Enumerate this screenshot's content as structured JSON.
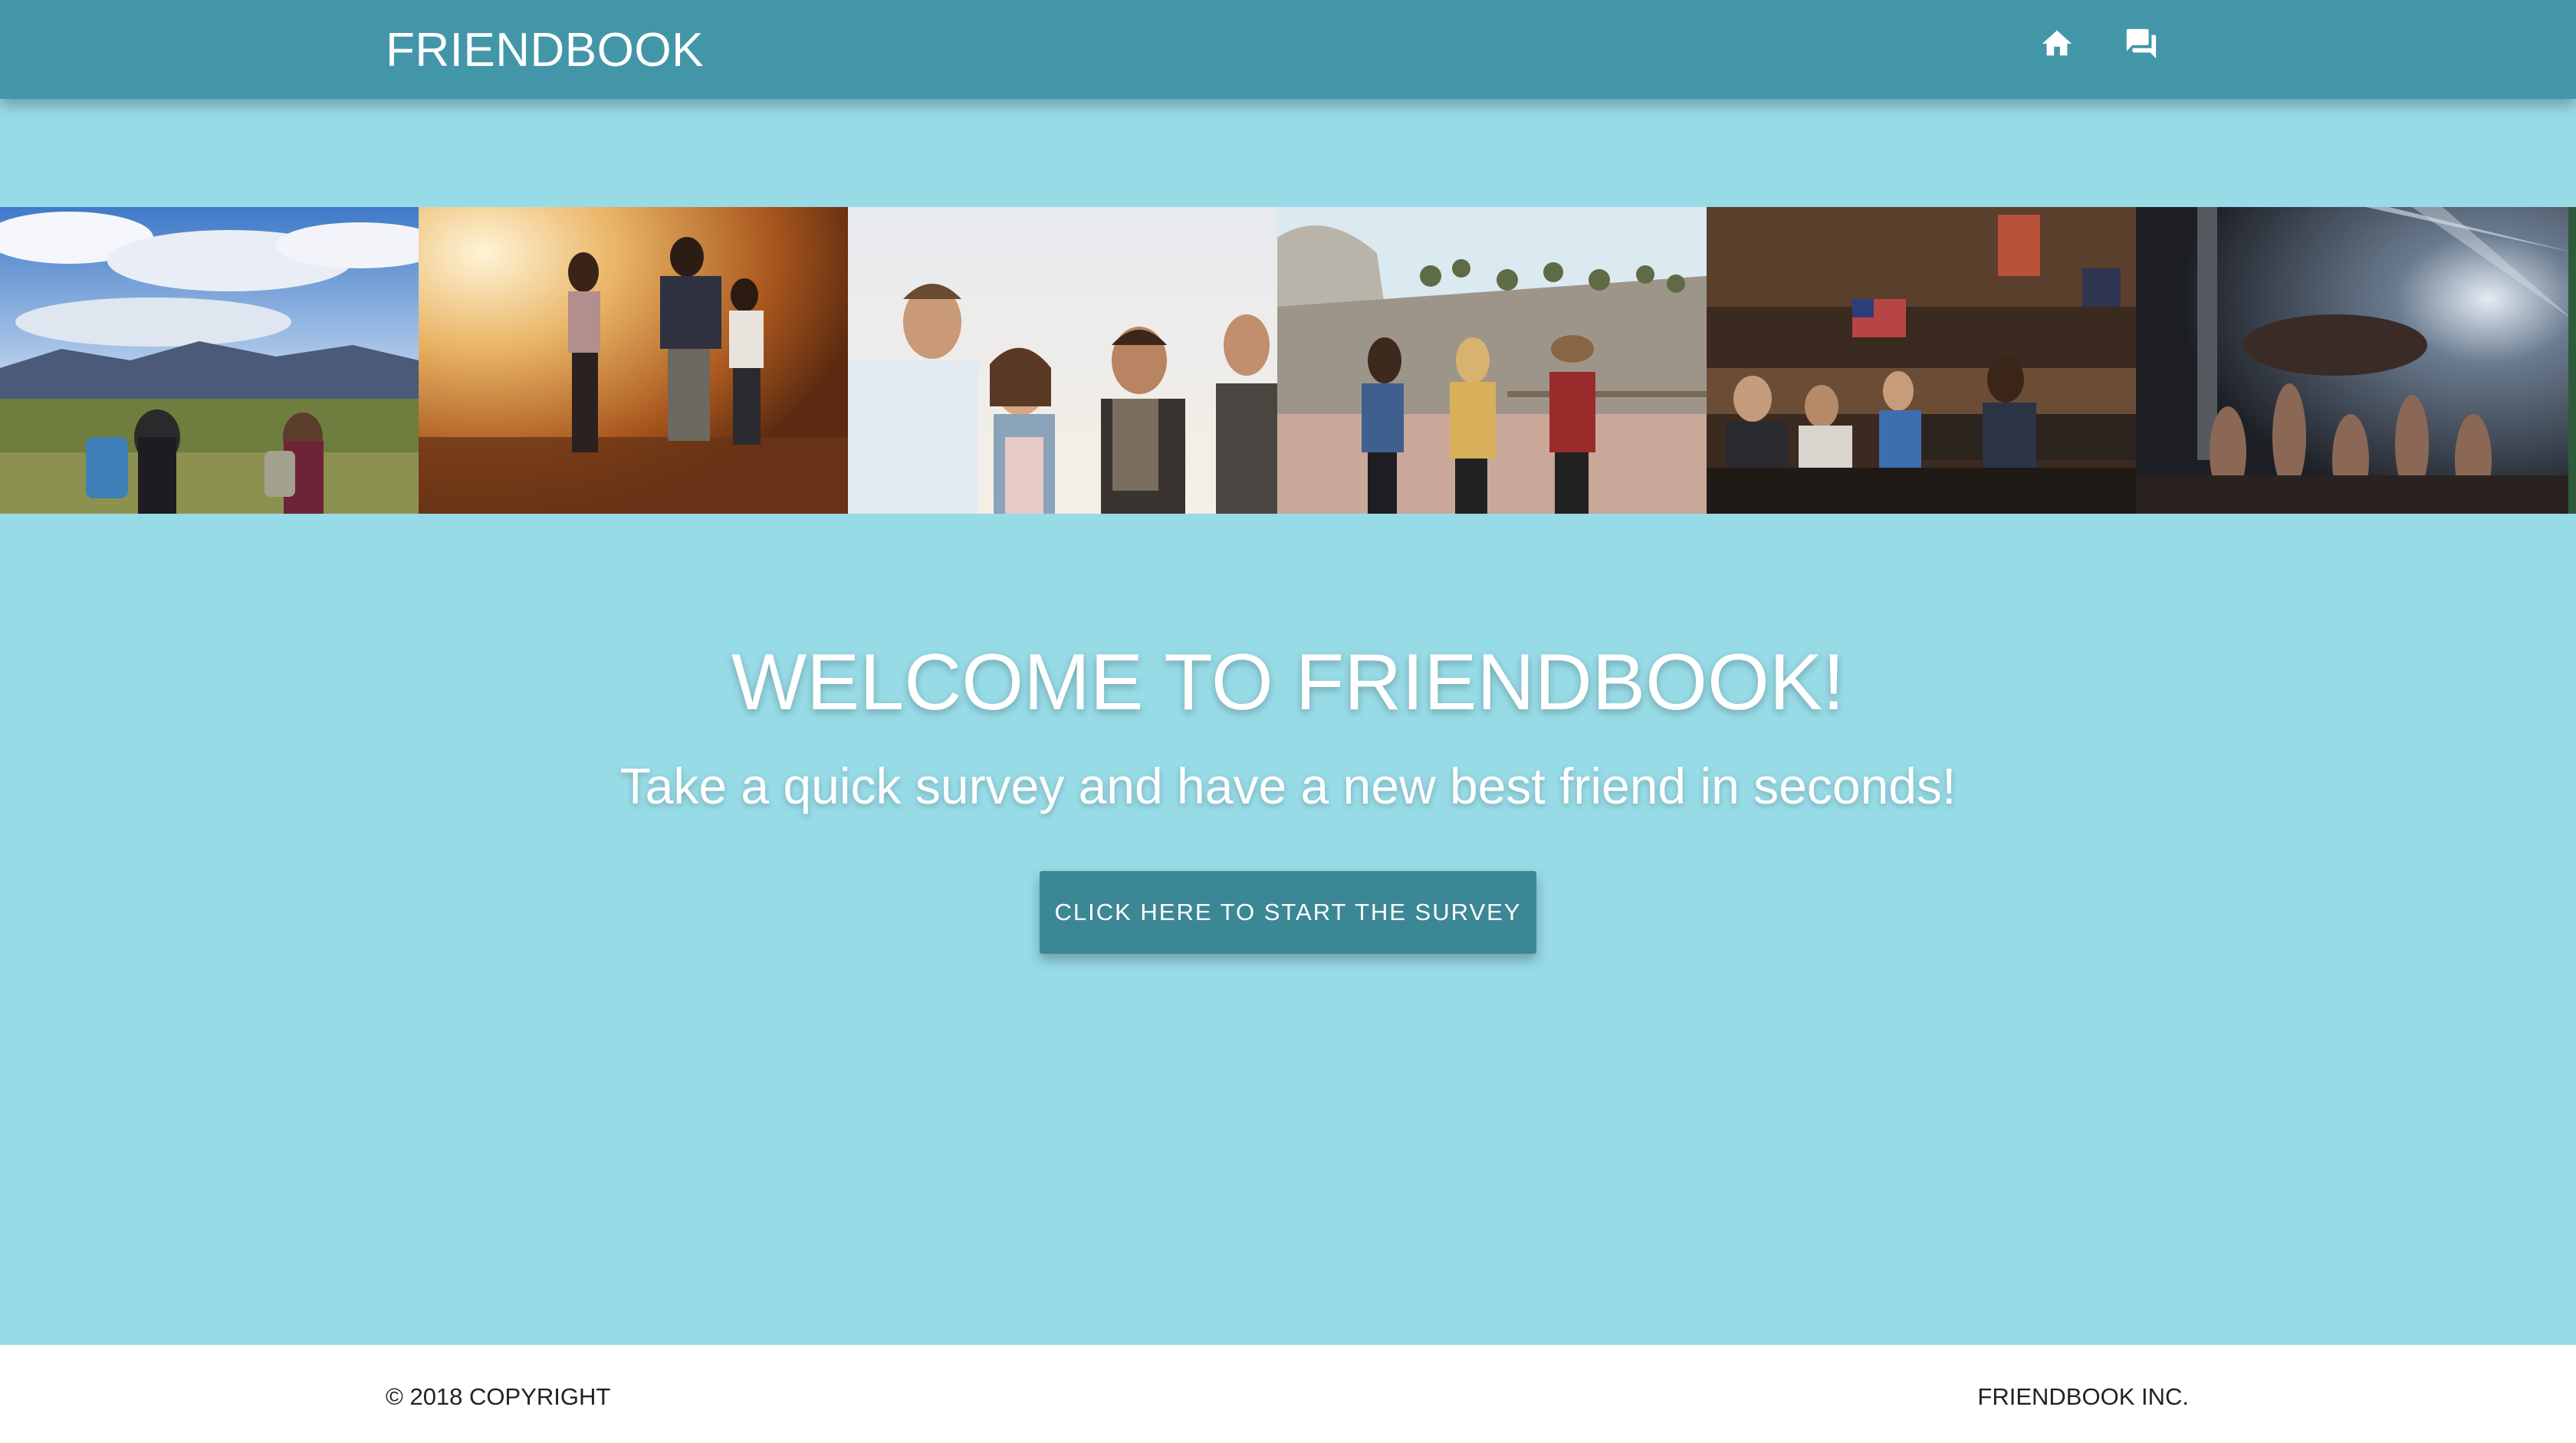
{
  "navbar": {
    "brand": "FRIENDBOOK",
    "icons": [
      "home-icon",
      "forum-icon"
    ],
    "color": "#4396a8"
  },
  "page": {
    "background": "#97dbe6"
  },
  "photos": [
    {
      "name": "hikers-mountain-photo"
    },
    {
      "name": "friends-sunset-photo"
    },
    {
      "name": "friends-laughing-photo"
    },
    {
      "name": "friends-walking-trail-photo"
    },
    {
      "name": "friends-bar-photo"
    },
    {
      "name": "concert-crowd-photo"
    }
  ],
  "hero": {
    "title": "WELCOME TO FRIENDBOOK!",
    "subtitle": "Take a quick survey and have a new best friend in seconds!",
    "cta_label": "CLICK HERE TO START THE SURVEY",
    "cta_color": "#3b8795"
  },
  "footer": {
    "copyright": "© 2018 COPYRIGHT",
    "company": "FRIENDBOOK INC."
  }
}
